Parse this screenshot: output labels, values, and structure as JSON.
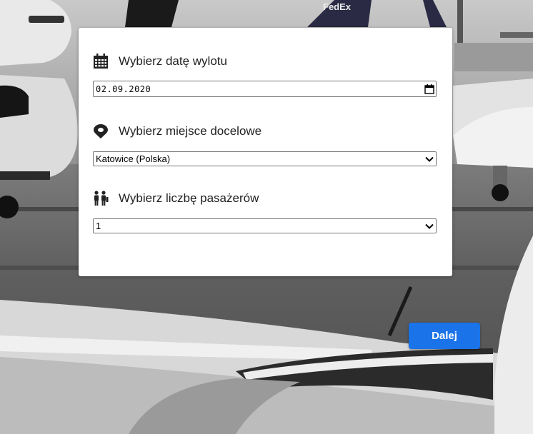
{
  "form": {
    "departure": {
      "label": "Wybierz datę wylotu",
      "icon": "calendar-icon",
      "value": "02.09.2020"
    },
    "destination": {
      "label": "Wybierz miejsce docelowe",
      "icon": "location-pin-icon",
      "value": "Katowice (Polska)"
    },
    "passengers": {
      "label": "Wybierz liczbę pasażerów",
      "icon": "passengers-icon",
      "value": "1"
    }
  },
  "actions": {
    "next_label": "Dalej"
  },
  "background": {
    "watermark_text": "FedEx"
  },
  "colors": {
    "accent": "#1a73e8",
    "panel": "#ffffff"
  }
}
